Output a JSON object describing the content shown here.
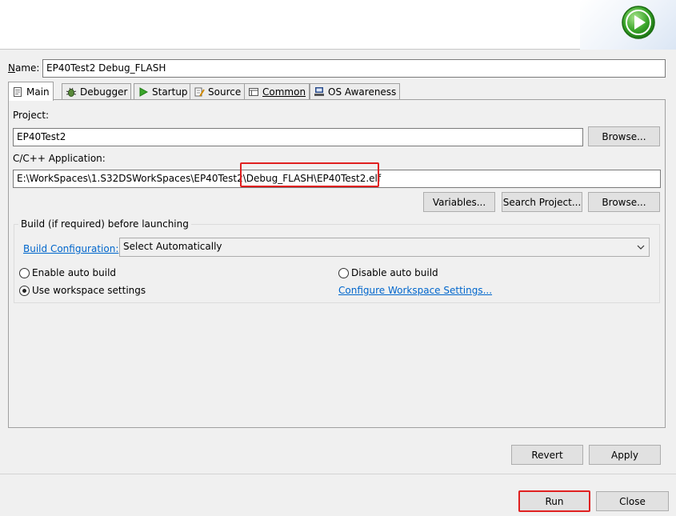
{
  "header": {
    "logo_icon": "run-play-icon"
  },
  "config": {
    "name_label_u": "N",
    "name_label_rest": "ame:",
    "name_value": "EP40Test2 Debug_FLASH"
  },
  "tabs": [
    {
      "label": "Main",
      "icon": "main-tab-icon",
      "active": true
    },
    {
      "label": "Debugger",
      "icon": "debugger-icon"
    },
    {
      "label": "Startup",
      "icon": "startup-icon"
    },
    {
      "label": "Source",
      "icon": "source-icon"
    },
    {
      "label": "Common",
      "icon": "common-icon"
    },
    {
      "label": "OS Awareness",
      "icon": "os-awareness-icon"
    }
  ],
  "main": {
    "project_label": "Project:",
    "project_value": "EP40Test2",
    "browse_label": "Browse...",
    "app_label": "C/C++ Application:",
    "app_value": "E:\\WorkSpaces\\1.S32DSWorkSpaces\\EP40Test2\\Debug_FLASH\\EP40Test2.elf",
    "variables_label": "Variables...",
    "search_project_label": "Search Project...",
    "browse2_label": "Browse...",
    "build_group_label": "Build (if required) before launching",
    "build_config_link": "Build Configuration:",
    "build_config_value": "Select Automatically",
    "enable_auto_build": "Enable auto build",
    "disable_auto_build": "Disable auto build",
    "use_workspace": "Use workspace settings",
    "configure_workspace_link": "Configure Workspace Settings..."
  },
  "footer": {
    "revert_label": "Revert",
    "apply_label": "Apply",
    "run_label": "Run",
    "close_label": "Close"
  },
  "colors": {
    "accent": "#0078d7",
    "link": "#0066cc",
    "highlight": "#e02020",
    "logo_green": "#3aa52a"
  }
}
